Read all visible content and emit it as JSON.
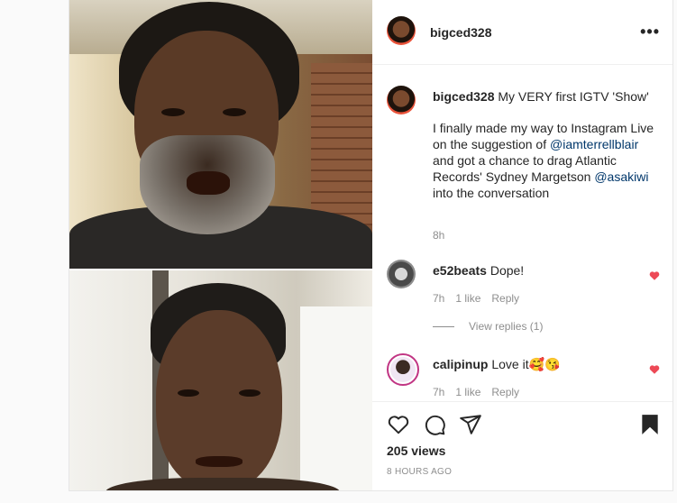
{
  "post": {
    "author": "bigced328",
    "caption_title": "My VERY first IGTV 'Show'",
    "caption_part1": "I finally made my way to Instagram Live on the suggestion of ",
    "caption_mention1": "@iamterrellblair",
    "caption_part2": " and got a chance to drag Atlantic Records' Sydney Margetson ",
    "caption_mention2": "@asakiwi",
    "caption_part3": " into the conversation",
    "caption_time": "8h"
  },
  "comments": [
    {
      "user": "e52beats",
      "text": "Dope!",
      "time": "7h",
      "likes": "1 like",
      "reply": "Reply"
    },
    {
      "user": "calipinup",
      "text": "Love it🥰😘",
      "time": "7h",
      "likes": "1 like",
      "reply": "Reply"
    }
  ],
  "view_replies": "View replies (1)",
  "stats": {
    "views": "205 views",
    "posted": "8 HOURS AGO"
  },
  "colors": {
    "like_red": "#ed4956",
    "mention_blue": "#00376b",
    "ring_pink": "#c13584"
  },
  "icons": {
    "more": "more-options-icon",
    "like": "heart-outline-icon",
    "comment": "comment-bubble-icon",
    "share": "paper-plane-icon",
    "save": "bookmark-filled-icon"
  }
}
